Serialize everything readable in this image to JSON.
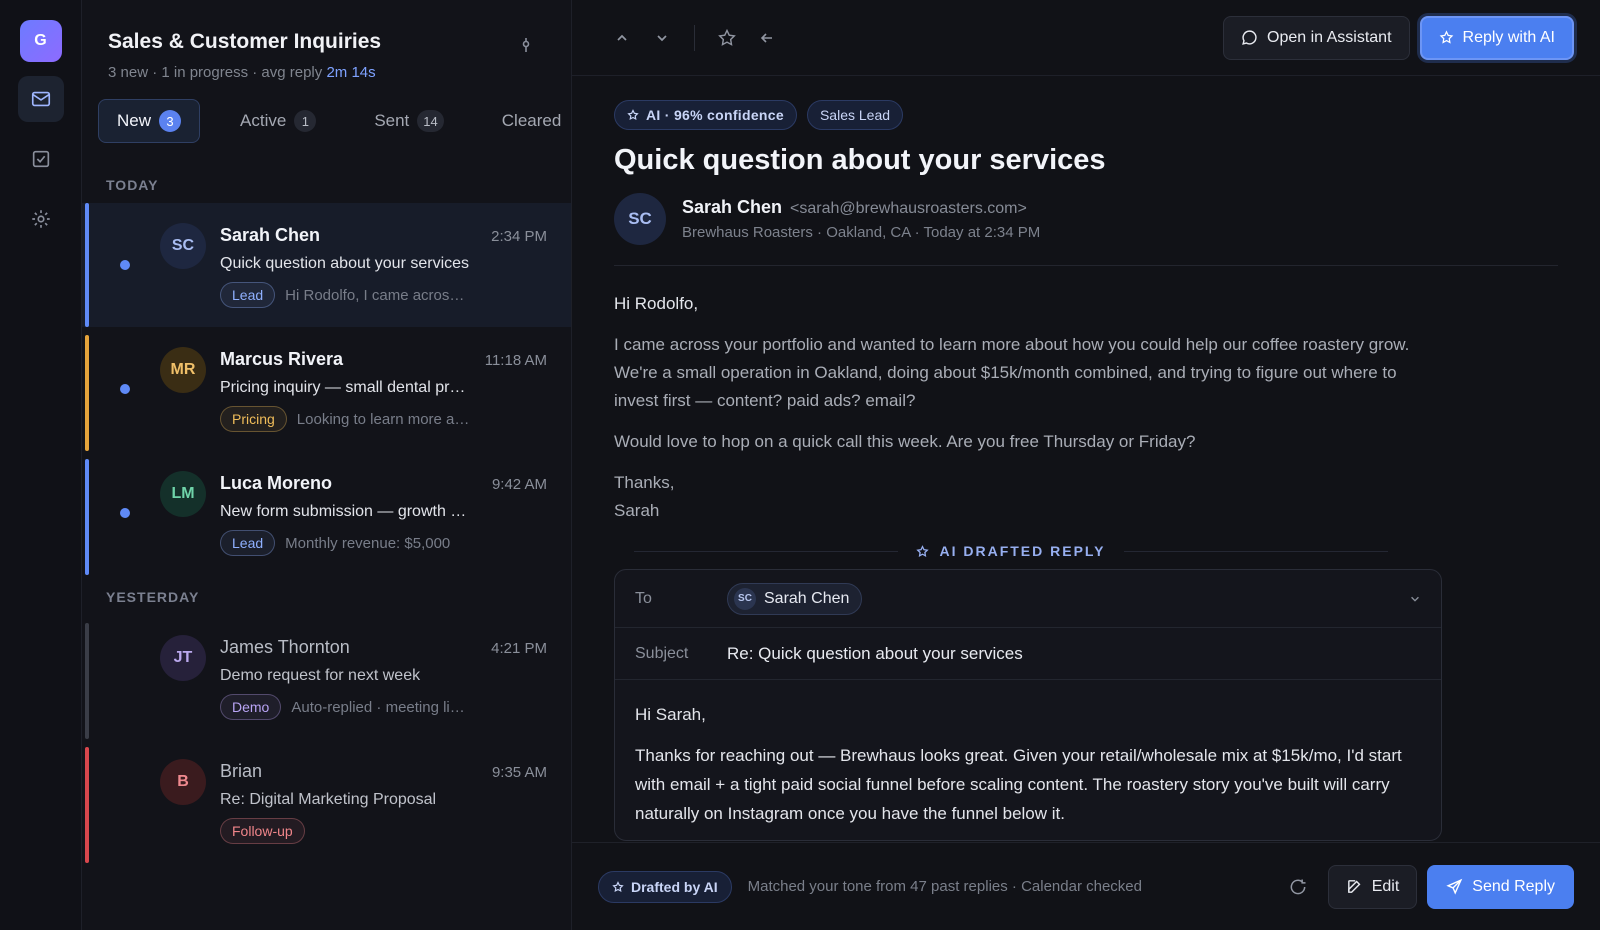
{
  "rail": {
    "logo": "G"
  },
  "inbox": {
    "title": "Sales & Customer Inquiries",
    "summary_prefix": "3 new · 1 in progress · avg reply ",
    "summary_accent": "2m 14s",
    "tabs": [
      {
        "label": "New",
        "count": "3"
      },
      {
        "label": "Active",
        "count": "1"
      },
      {
        "label": "Sent",
        "count": "14"
      },
      {
        "label": "Cleared",
        "count": ""
      }
    ],
    "sections": {
      "today": "TODAY",
      "yesterday": "YESTERDAY"
    },
    "items": [
      {
        "initials": "SC",
        "name": "Sarah Chen",
        "time": "2:34 PM",
        "subject": "Quick question about your services",
        "tag": "Lead",
        "preview": "Hi Rodolfo, I came across your portfolio",
        "bar_color": "#5f8af7",
        "tag_color": "#8fb0ff",
        "avatar_bg": "#1e2740",
        "avatar_fg": "#a9bdf2"
      },
      {
        "initials": "MR",
        "name": "Marcus Rivera",
        "time": "11:18 AM",
        "subject": "Pricing inquiry — small dental practice",
        "tag": "Pricing",
        "preview": "Looking to learn more about pricing",
        "bar_color": "#e5a43b",
        "tag_color": "#f0bd5a",
        "avatar_bg": "#3a2d14",
        "avatar_fg": "#f0c069"
      },
      {
        "initials": "LM",
        "name": "Luca Moreno",
        "time": "9:42 AM",
        "subject": "New form submission — growth audit",
        "tag": "Lead",
        "preview": "Monthly revenue: $5,000",
        "bar_color": "#5f8af7",
        "tag_color": "#8fb0ff",
        "avatar_bg": "#14302a",
        "avatar_fg": "#6fd3a9"
      },
      {
        "initials": "JT",
        "name": "James Thornton",
        "time": "4:21 PM",
        "subject": "Demo request for next week",
        "tag": "Demo",
        "preview": "Auto-replied · meeting link sent",
        "bar_color": "#3a3d47",
        "tag_color": "#b9a4f5",
        "avatar_bg": "#26213a",
        "avatar_fg": "#bba9ee"
      },
      {
        "initials": "B",
        "name": "Brian",
        "time": "9:35 AM",
        "subject": "Re: Digital Marketing Proposal",
        "tag": "Follow-up",
        "preview": "",
        "bar_color": "#d8474d",
        "tag_color": "#f0858a",
        "avatar_bg": "#3a1b1e",
        "avatar_fg": "#ef8a8f"
      }
    ]
  },
  "toolbar": {
    "open_assistant": "Open in Assistant",
    "reply_ai": "Reply with AI"
  },
  "message": {
    "confidence": "AI · 96% confidence",
    "category": "Sales Lead",
    "title": "Quick question about your services",
    "sender_initials": "SC",
    "sender_name": "Sarah Chen",
    "sender_email": "<sarah@brewhausroasters.com>",
    "sender_meta": "Brewhaus Roasters · Oakland, CA · Today at 2:34 PM",
    "greeting": "Hi Rodolfo,",
    "para1": "I came across your portfolio and wanted to learn more about how you could help our coffee roastery grow. We're a small operation in Oakland, doing about $15k/month combined, and trying to figure out where to invest first — content? paid ads? email?",
    "para2": "Would love to hop on a quick call this week. Are you free Thursday or Friday?",
    "signoff": "Thanks,",
    "signature": "Sarah"
  },
  "draft": {
    "heading": "AI DRAFTED REPLY",
    "to_label": "To",
    "to_initials": "SC",
    "to_name": "Sarah Chen",
    "subject_label": "Subject",
    "subject": "Re: Quick question about your services",
    "greeting": "Hi Sarah,",
    "para1": "Thanks for reaching out — Brewhaus looks great. Given your retail/wholesale mix at $15k/mo, I'd start with email + a tight paid social funnel before scaling content. The roastery story you've built will carry naturally on Instagram once you have the funnel below it."
  },
  "footer": {
    "badge": "Drafted by AI",
    "note": "Matched your tone from 47 past replies · Calendar checked",
    "edit": "Edit",
    "send": "Send Reply"
  }
}
